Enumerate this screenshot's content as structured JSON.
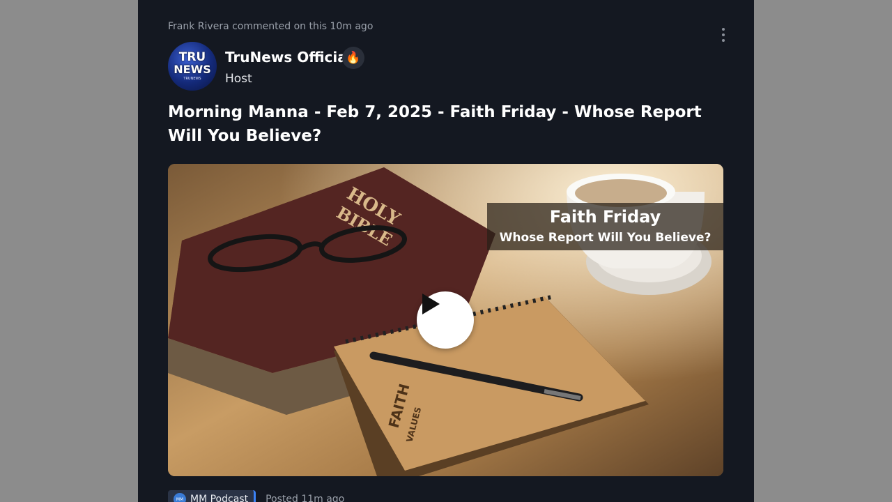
{
  "post": {
    "activity": "Frank Rivera commented on this 10m ago",
    "author": {
      "name": "TruNews Official",
      "badge": "🔥",
      "role": "Host",
      "avatar": {
        "line1": "TRU",
        "line2": "NEWS",
        "line3": "TRUNEWS"
      }
    },
    "title": "Morning Manna - Feb 7, 2025 - Faith Friday - Whose Report Will You Believe?",
    "thumbnail": {
      "overlay_title": "Faith Friday",
      "overlay_subtitle": "Whose Report Will You Believe?",
      "book_text_1": "HOLY",
      "book_text_2": "BIBLE",
      "notebook_text_1": "FAITH",
      "notebook_text_2": "VALUES"
    },
    "footer": {
      "tag_icon": "MM",
      "tag_label": "MM Podcast",
      "posted": "Posted 11m ago"
    }
  },
  "colors": {
    "page_bg": "#8c8c8c",
    "card_bg": "#141821",
    "accent": "#3b82f6"
  }
}
